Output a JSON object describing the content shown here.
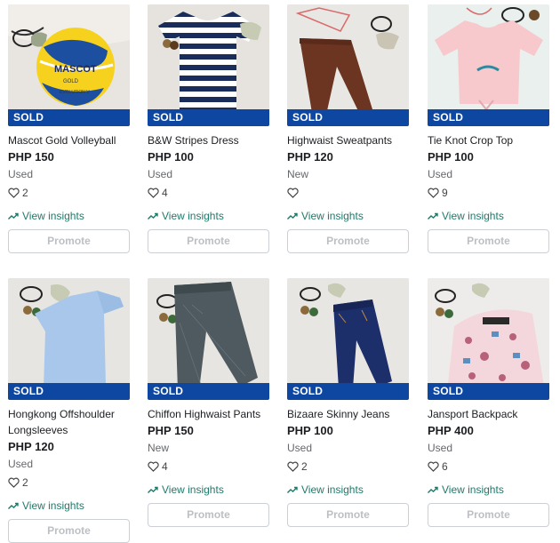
{
  "listings": [
    {
      "sold_label": "SOLD",
      "title": "Mascot Gold Volleyball",
      "price": "PHP 150",
      "condition": "Used",
      "likes": "2",
      "insights_label": "View insights",
      "promote_label": "Promote",
      "image": "volleyball"
    },
    {
      "sold_label": "SOLD",
      "title": "B&W Stripes Dress",
      "price": "PHP 100",
      "condition": "Used",
      "likes": "4",
      "insights_label": "View insights",
      "promote_label": "Promote",
      "image": "striped-dress"
    },
    {
      "sold_label": "SOLD",
      "title": "Highwaist Sweatpants",
      "price": "PHP 120",
      "condition": "New",
      "likes": "",
      "insights_label": "View insights",
      "promote_label": "Promote",
      "image": "brown-pants"
    },
    {
      "sold_label": "SOLD",
      "title": "Tie Knot Crop Top",
      "price": "PHP 100",
      "condition": "Used",
      "likes": "9",
      "insights_label": "View insights",
      "promote_label": "Promote",
      "image": "pink-top"
    },
    {
      "sold_label": "SOLD",
      "title": "Hongkong Offshoulder Longsleeves",
      "price": "PHP 120",
      "condition": "Used",
      "likes": "2",
      "insights_label": "View insights",
      "promote_label": "Promote",
      "image": "blue-top"
    },
    {
      "sold_label": "SOLD",
      "title": "Chiffon Highwaist Pants",
      "price": "PHP 150",
      "condition": "New",
      "likes": "4",
      "insights_label": "View insights",
      "promote_label": "Promote",
      "image": "gray-pants"
    },
    {
      "sold_label": "SOLD",
      "title": "Bizaare Skinny Jeans",
      "price": "PHP 100",
      "condition": "Used",
      "likes": "2",
      "insights_label": "View insights",
      "promote_label": "Promote",
      "image": "jeans"
    },
    {
      "sold_label": "SOLD",
      "title": "Jansport Backpack",
      "price": "PHP 400",
      "condition": "Used",
      "likes": "6",
      "insights_label": "View insights",
      "promote_label": "Promote",
      "image": "backpack"
    }
  ],
  "colors": {
    "sold_banner": "#0d47a1",
    "insights": "#1f7a6b",
    "promote_text": "#bcc0c4"
  },
  "icons": {
    "like": "heart-outline-icon",
    "insights": "trending-up-icon"
  }
}
